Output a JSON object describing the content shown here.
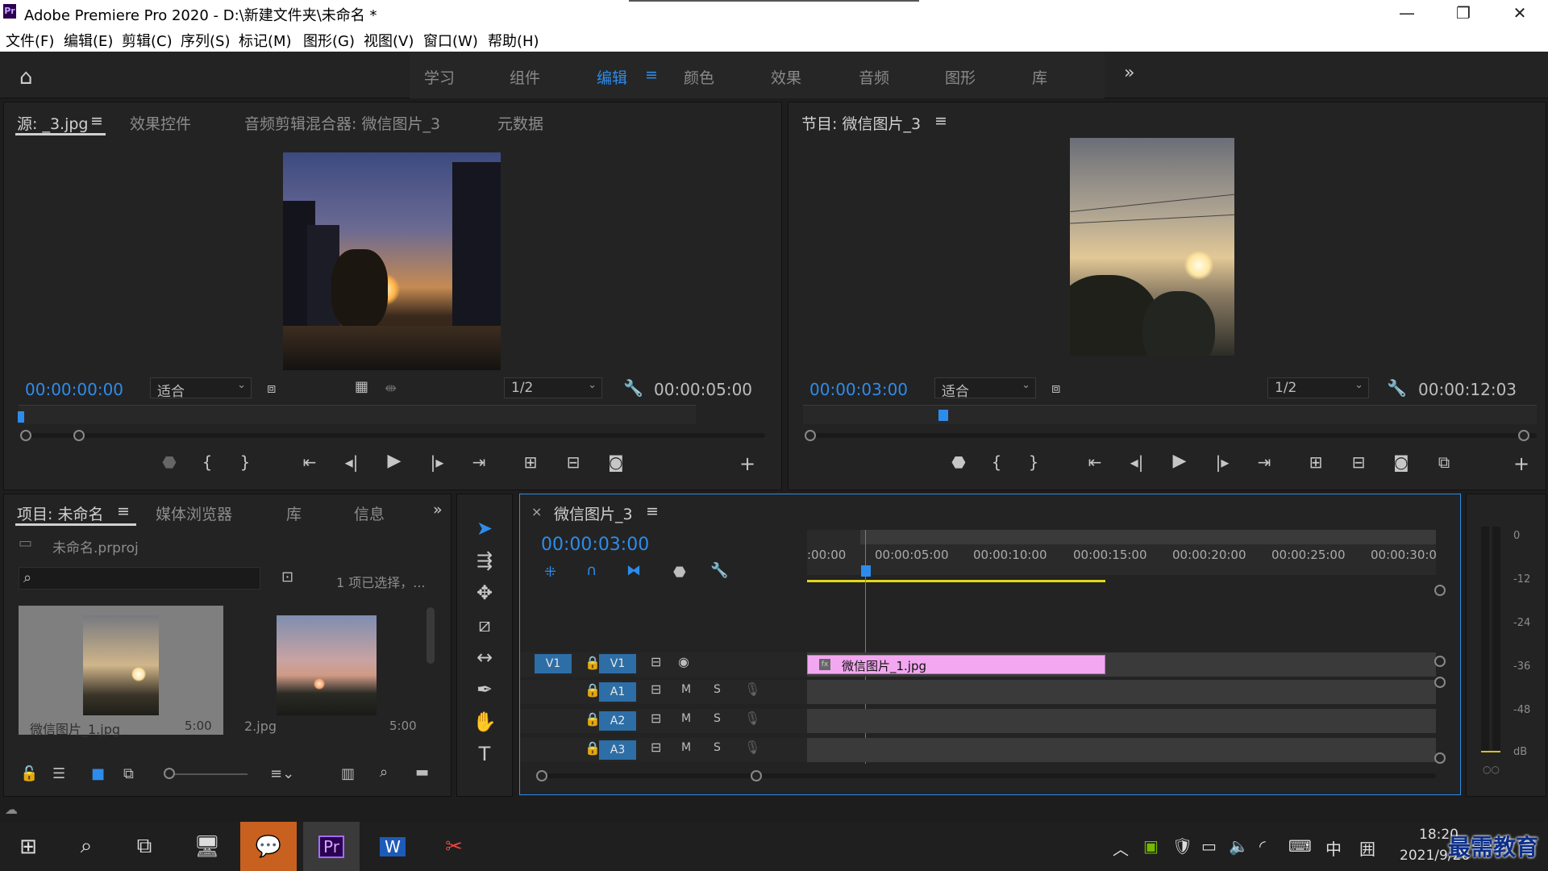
{
  "window": {
    "title": "Adobe Premiere Pro 2020 - D:\\新建文件夹\\未命名 *",
    "app_badge": "Pr",
    "minimize": "—",
    "maximize": "❐",
    "close": "✕"
  },
  "menu": [
    "文件(F)",
    "编辑(E)",
    "剪辑(C)",
    "序列(S)",
    "标记(M)",
    "图形(G)",
    "视图(V)",
    "窗口(W)",
    "帮助(H)"
  ],
  "workspaces": {
    "tabs": [
      "学习",
      "组件",
      "编辑",
      "颜色",
      "效果",
      "音频",
      "图形",
      "库"
    ],
    "active": "编辑",
    "menu_icon": "≡",
    "overflow": "»"
  },
  "source_monitor": {
    "tabs": [
      "源: _3.jpg",
      "效果控件",
      "音频剪辑混合器: 微信图片_3",
      "元数据"
    ],
    "current_time": "00:00:00:00",
    "fit": "适合",
    "resolution": "1/2",
    "duration": "00:00:05:00"
  },
  "program_monitor": {
    "tab": "节目: 微信图片_3",
    "current_time": "00:00:03:00",
    "fit": "适合",
    "resolution": "1/2",
    "duration": "00:00:12:03"
  },
  "project": {
    "tabs": [
      "项目: 未命名",
      "媒体浏览器",
      "库",
      "信息"
    ],
    "file": "未命名.prproj",
    "selection": "1 项已选择，...",
    "items": [
      {
        "name": "微信图片_1.jpg",
        "duration": "5:00"
      },
      {
        "name": "2.jpg",
        "duration": "5:00"
      }
    ]
  },
  "timeline": {
    "close": "×",
    "sequence": "微信图片_3",
    "current_time": "00:00:03:00",
    "ruler": [
      ":00:00",
      "00:00:05:00",
      "00:00:10:00",
      "00:00:15:00",
      "00:00:20:00",
      "00:00:25:00",
      "00:00:30:0"
    ],
    "video_track": {
      "source": "V1",
      "target": "V1"
    },
    "audio_tracks": [
      "A1",
      "A2",
      "A3"
    ],
    "mute_label": "M",
    "solo_label": "S",
    "clip": {
      "name": "微信图片_1.jpg",
      "badge": "fx",
      "color": "#f3a7f0"
    },
    "work_area_color": "#e3d71a"
  },
  "audio_meter": {
    "scale": [
      "0",
      "-12",
      "-24",
      "-36",
      "-48",
      "dB"
    ]
  },
  "taskbar": {
    "clock_time": "18:20",
    "clock_date": "2021/9/26",
    "ime": "中",
    "watermark": "最需教育"
  }
}
